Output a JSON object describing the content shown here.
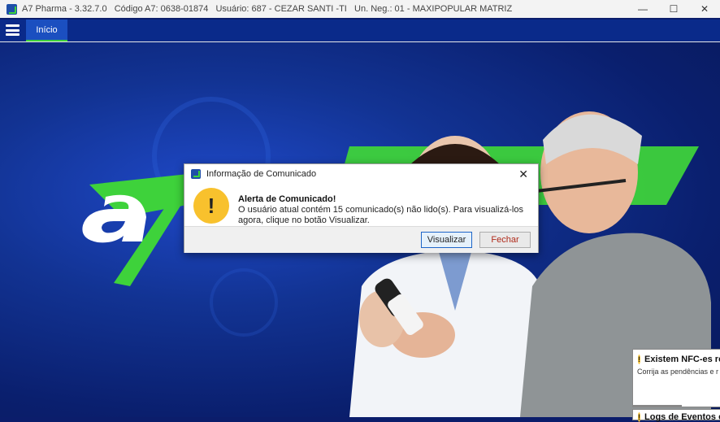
{
  "window": {
    "title": "A7 Pharma - 3.32.7.0   Código A7: 0638-01874   Usuário: 687 - CEZAR SANTI -TI   Un. Neg.: 01 - MAXIPOPULAR MATRIZ",
    "minimize": "—",
    "maximize": "☐",
    "close": "✕"
  },
  "menu": {
    "tab_inicio": "Início"
  },
  "dialog": {
    "title": "Informação de Comunicado",
    "close": "✕",
    "icon_glyph": "!",
    "heading": "Alerta de Comunicado!",
    "message": "O usuário atual contém 15 comunicado(s) não lido(s). Para visualizá-los agora, clique no botão Visualizar.",
    "visualizar_label": "Visualizar",
    "fechar_label": "Fechar"
  },
  "toasts": [
    {
      "icon": "!",
      "title": "Existem NFC-es re",
      "text": "Corrija as pendências e r"
    },
    {
      "icon": "!",
      "title": "Logs de Eventos e",
      "text": ""
    }
  ],
  "colors": {
    "brand_blue": "#0a2a8a",
    "brand_green": "#3ed23b",
    "warning_yellow": "#f8c12d"
  }
}
